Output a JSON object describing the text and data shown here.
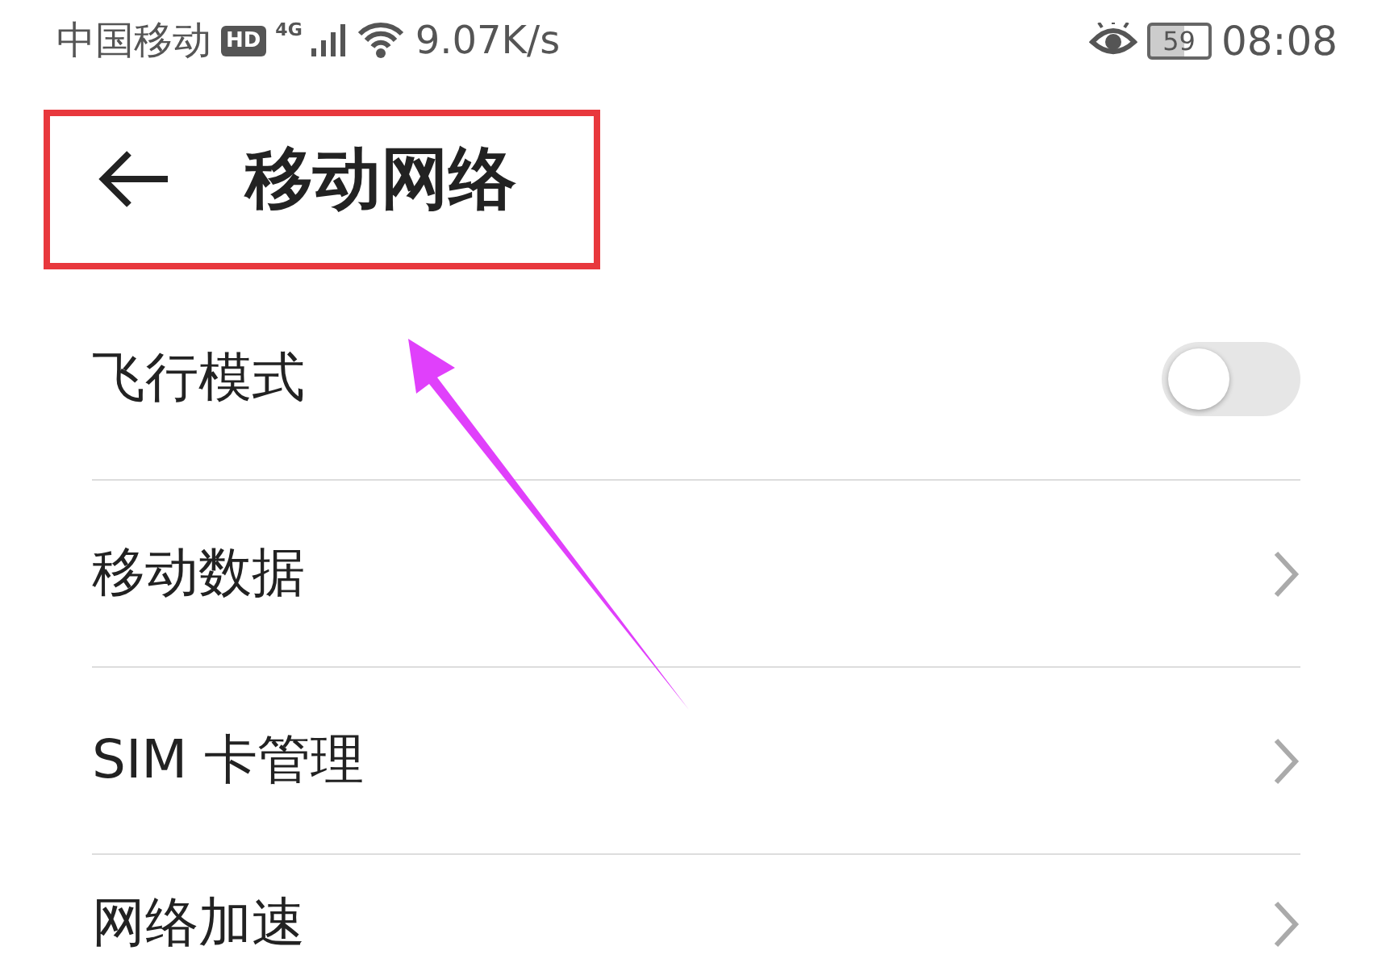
{
  "status_bar": {
    "carrier": "中国移动",
    "hd_badge": "HD",
    "network": "4G",
    "speed": "9.07K/s",
    "battery": "59",
    "time": "08:08"
  },
  "header": {
    "title": "移动网络"
  },
  "items": [
    {
      "kind": "toggle",
      "label": "飞行模式",
      "on": false
    },
    {
      "kind": "link",
      "label": "移动数据"
    },
    {
      "kind": "link",
      "label": "SIM 卡管理"
    },
    {
      "kind": "link",
      "label": "网络加速"
    }
  ]
}
